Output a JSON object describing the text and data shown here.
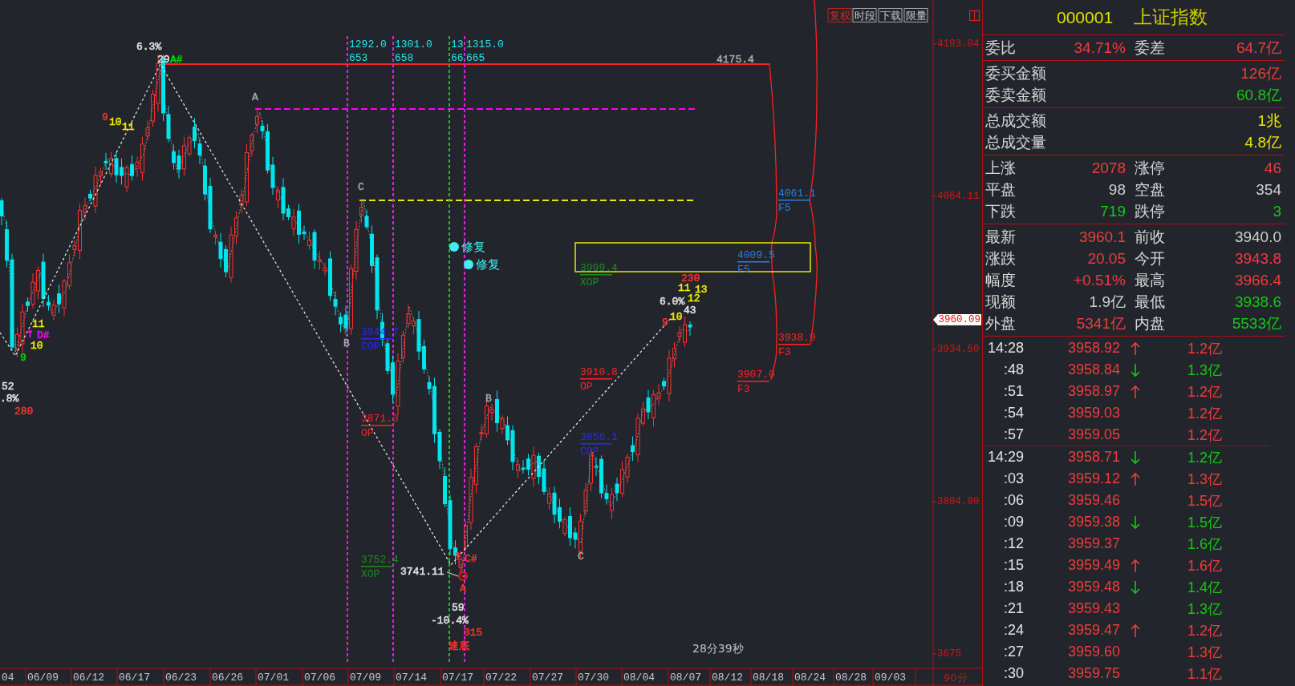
{
  "chart": {
    "toolbar": [
      {
        "label": "复权",
        "selected": true
      },
      {
        "label": "时段",
        "selected": false
      },
      {
        "label": "下载",
        "selected": false
      },
      {
        "label": "限量",
        "selected": false
      }
    ],
    "cycle_lines": [
      {
        "color": "#e020e0",
        "value": "1292.0",
        "count": "653"
      },
      {
        "color": "#e020e0",
        "value": "1301.0",
        "count": "658"
      },
      {
        "color": "#20c020",
        "value": "13",
        "count": "66"
      },
      {
        "color": "#e020e0",
        "value": "1315.0",
        "count": "665"
      }
    ],
    "signals": [
      {
        "text": "修复"
      },
      {
        "text": "修复"
      }
    ],
    "annotations": [
      {
        "kind": "label",
        "text": "6.3%",
        "color": "#e6e6e6"
      },
      {
        "kind": "label",
        "text": "29",
        "color": "#e6e6e6"
      },
      {
        "kind": "label",
        "text": "A#",
        "color": "#00dd00"
      },
      {
        "kind": "label",
        "text": "4175.4",
        "color": "#a6a6a6"
      },
      {
        "kind": "label",
        "text": "9",
        "color": "#ff3030"
      },
      {
        "kind": "label",
        "text": "10",
        "color": "#f0f000"
      },
      {
        "kind": "label",
        "text": "11",
        "color": "#f0f000"
      },
      {
        "kind": "label",
        "text": "A",
        "color": "#a6a6a6"
      },
      {
        "kind": "label",
        "text": "C",
        "color": "#a6a6a6"
      },
      {
        "kind": "label",
        "text": "11",
        "color": "#f0f000"
      },
      {
        "kind": "arrow",
        "text": "↑",
        "color": "#ff00ff"
      },
      {
        "kind": "label",
        "text": "D#",
        "color": "#ff00ff"
      },
      {
        "kind": "label",
        "text": "B",
        "color": "#a6a6a6"
      },
      {
        "kind": "label",
        "text": "10",
        "color": "#f0f000"
      },
      {
        "kind": "label",
        "text": "9",
        "color": "#00dd00"
      },
      {
        "kind": "label",
        "text": "52",
        "color": "#e6e6e6"
      },
      {
        "kind": "label",
        "text": ".8%",
        "color": "#e6e6e6"
      },
      {
        "kind": "label",
        "text": "280",
        "color": "#ff3030"
      },
      {
        "kind": "arrow",
        "text": "↑",
        "color": "#ff3030"
      },
      {
        "kind": "label",
        "text": "C#",
        "color": "#ff3030"
      },
      {
        "kind": "label",
        "text": "3741.11",
        "color": "#e6e6e6"
      },
      {
        "kind": "label",
        "text": "A",
        "color": "#ff3030"
      },
      {
        "kind": "label",
        "text": "59",
        "color": "#e6e6e6"
      },
      {
        "kind": "label",
        "text": "-10.4%",
        "color": "#e6e6e6"
      },
      {
        "kind": "label",
        "text": "315",
        "color": "#ff3030"
      },
      {
        "kind": "label",
        "text": "速底",
        "color": "#ff3030"
      },
      {
        "kind": "label",
        "text": "B",
        "color": "#a6a6a6"
      },
      {
        "kind": "label",
        "text": "C",
        "color": "#a6a6a6"
      },
      {
        "kind": "label",
        "text": "230",
        "color": "#ff3030"
      },
      {
        "kind": "label",
        "text": "11",
        "color": "#f0f000"
      },
      {
        "kind": "label",
        "text": "13",
        "color": "#f0f000"
      },
      {
        "kind": "label",
        "text": "12",
        "color": "#f0f000"
      },
      {
        "kind": "label",
        "text": "6.0%",
        "color": "#e6e6e6"
      },
      {
        "kind": "label",
        "text": "43",
        "color": "#e6e6e6"
      },
      {
        "kind": "label",
        "text": "10",
        "color": "#f0f000"
      },
      {
        "kind": "label",
        "text": "9",
        "color": "#ff3030"
      }
    ],
    "price_levels": [
      {
        "value": "4061.1",
        "tag": "F5",
        "color": "#2f7fe0"
      },
      {
        "value": "4009.5",
        "tag": "F5",
        "color": "#2f7fe0"
      },
      {
        "value": "3999.4",
        "tag": "XOP",
        "color": "#1e8c1e"
      },
      {
        "value": "3944.7",
        "tag": "COP",
        "color": "#2828ff"
      },
      {
        "value": "3938.9",
        "tag": "F3",
        "color": "#ff2424"
      },
      {
        "value": "3910.8",
        "tag": "OP",
        "color": "#ff2424"
      },
      {
        "value": "3907.0",
        "tag": "F3",
        "color": "#ff2424"
      },
      {
        "value": "3871.3",
        "tag": "OP",
        "color": "#ff2424"
      },
      {
        "value": "3856.1",
        "tag": "COP",
        "color": "#2828ff"
      },
      {
        "value": "3752.4",
        "tag": "XOP",
        "color": "#1e8c1e"
      }
    ],
    "timer": "28分39秒",
    "dates": [
      "04",
      "06/09",
      "06/12",
      "06/17",
      "06/23",
      "06/26",
      "07/01",
      "07/06",
      "07/09",
      "07/14",
      "07/17",
      "07/22",
      "07/27",
      "07/30",
      "08/04",
      "08/07",
      "08/12",
      "08/18",
      "08/24",
      "08/28",
      "09/03"
    ]
  },
  "price_axis": {
    "ticks": [
      "4193.04",
      "4064.11",
      "3934.50",
      "3804.90",
      "3675"
    ],
    "current": "3960.09",
    "period": "90分"
  },
  "quote": {
    "code": "000001",
    "name": "上证指数",
    "sections": [
      {
        "rows": [
          {
            "fields": [
              {
                "label": "委比",
                "value": "34.71%",
                "color": "#f03c3c"
              },
              {
                "label": "委差",
                "value": "64.7亿",
                "color": "#f03c3c"
              }
            ]
          }
        ]
      },
      {
        "rows": [
          {
            "fields": [
              {
                "label": "委买金额",
                "value": "126亿",
                "color": "#f03c3c"
              }
            ]
          },
          {
            "fields": [
              {
                "label": "委卖金额",
                "value": "60.8亿",
                "color": "#14c814"
              }
            ]
          }
        ]
      },
      {
        "rows": [
          {
            "fields": [
              {
                "label": "总成交额",
                "value": "1兆",
                "color": "#e6e600"
              }
            ]
          },
          {
            "fields": [
              {
                "label": "总成交量",
                "value": "4.8亿",
                "color": "#e6e600"
              }
            ]
          }
        ]
      },
      {
        "rows": [
          {
            "fields": [
              {
                "label": "上涨",
                "value": "2078",
                "color": "#f03c3c"
              },
              {
                "label": "涨停",
                "value": "46",
                "color": "#f03c3c"
              }
            ]
          },
          {
            "fields": [
              {
                "label": "平盘",
                "value": "98",
                "color": "#d0d0d0"
              },
              {
                "label": "空盘",
                "value": "354",
                "color": "#d0d0d0"
              }
            ]
          },
          {
            "fields": [
              {
                "label": "下跌",
                "value": "719",
                "color": "#14c814"
              },
              {
                "label": "跌停",
                "value": "3",
                "color": "#14c814"
              }
            ]
          }
        ]
      },
      {
        "rows": [
          {
            "fields": [
              {
                "label": "最新",
                "value": "3960.1",
                "color": "#f03c3c"
              },
              {
                "label": "前收",
                "value": "3940.0",
                "color": "#d0d0d0"
              }
            ]
          },
          {
            "fields": [
              {
                "label": "涨跌",
                "value": "20.05",
                "color": "#f03c3c"
              },
              {
                "label": "今开",
                "value": "3943.8",
                "color": "#f03c3c"
              }
            ]
          },
          {
            "fields": [
              {
                "label": "幅度",
                "value": "+0.51%",
                "color": "#f03c3c"
              },
              {
                "label": "最高",
                "value": "3966.4",
                "color": "#f03c3c"
              }
            ]
          },
          {
            "fields": [
              {
                "label": "现额",
                "value": "1.9亿",
                "color": "#d0d0d0"
              },
              {
                "label": "最低",
                "value": "3938.6",
                "color": "#14c814"
              }
            ]
          },
          {
            "fields": [
              {
                "label": "外盘",
                "value": "5341亿",
                "color": "#f03c3c"
              },
              {
                "label": "内盘",
                "value": "5533亿",
                "color": "#14c814"
              }
            ]
          }
        ]
      }
    ]
  },
  "tick_groups": [
    {
      "ticks": [
        {
          "time": "14:28",
          "price": "3958.92",
          "kind": "up",
          "volume": "1.2亿",
          "color": "#f03c3c"
        },
        {
          "time": ":48",
          "price": "3958.84",
          "kind": "down",
          "volume": "1.3亿",
          "color": "#14c814"
        },
        {
          "time": ":51",
          "price": "3958.97",
          "kind": "up",
          "volume": "1.2亿",
          "color": "#f03c3c"
        },
        {
          "time": ":54",
          "price": "3959.03",
          "kind": "flat",
          "volume": "1.2亿",
          "color": "#f03c3c"
        },
        {
          "time": ":57",
          "price": "3959.05",
          "kind": "flat",
          "volume": "1.2亿",
          "color": "#f03c3c"
        }
      ]
    },
    {
      "ticks": [
        {
          "time": "14:29",
          "price": "3958.71",
          "kind": "down",
          "volume": "1.2亿",
          "color": "#14c814"
        },
        {
          "time": ":03",
          "price": "3959.12",
          "kind": "up",
          "volume": "1.3亿",
          "color": "#f03c3c"
        },
        {
          "time": ":06",
          "price": "3959.46",
          "kind": "flat",
          "volume": "1.5亿",
          "color": "#f03c3c"
        },
        {
          "time": ":09",
          "price": "3959.38",
          "kind": "down",
          "volume": "1.5亿",
          "color": "#14c814"
        },
        {
          "time": ":12",
          "price": "3959.37",
          "kind": "flat",
          "volume": "1.6亿",
          "color": "#14c814"
        },
        {
          "time": ":15",
          "price": "3959.49",
          "kind": "up",
          "volume": "1.6亿",
          "color": "#f03c3c"
        },
        {
          "time": ":18",
          "price": "3959.48",
          "kind": "down",
          "volume": "1.4亿",
          "color": "#14c814"
        },
        {
          "time": ":21",
          "price": "3959.43",
          "kind": "flat",
          "volume": "1.3亿",
          "color": "#14c814"
        },
        {
          "time": ":24",
          "price": "3959.47",
          "kind": "up",
          "volume": "1.2亿",
          "color": "#f03c3c"
        },
        {
          "time": ":27",
          "price": "3959.60",
          "kind": "flat",
          "volume": "1.3亿",
          "color": "#f03c3c"
        },
        {
          "time": ":30",
          "price": "3959.75",
          "kind": "flat",
          "volume": "1.1亿",
          "color": "#f03c3c"
        }
      ]
    }
  ]
}
